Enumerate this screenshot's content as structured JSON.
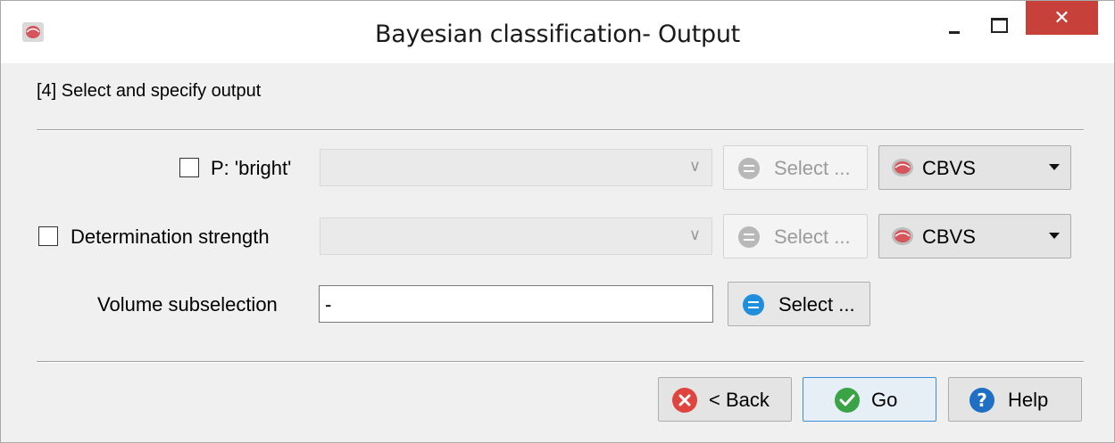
{
  "window": {
    "title": "Bayesian classification- Output",
    "close_symbol": "✕"
  },
  "step_label": "[4] Select and specify output",
  "rows": [
    {
      "checkbox_label": "P: 'bright'",
      "checked": false,
      "combo_value": "",
      "select_label": "Select ...",
      "format_label": "CBVS"
    },
    {
      "checkbox_label": "Determination strength",
      "checked": false,
      "combo_value": "",
      "select_label": "Select ...",
      "format_label": "CBVS"
    }
  ],
  "volume_subselection": {
    "label": "Volume subselection",
    "value": "-",
    "select_label": "Select ..."
  },
  "buttons": {
    "back": "< Back",
    "go": "Go",
    "help": "Help"
  },
  "icons": {
    "app": "opendtect-logo-icon",
    "select_disabled": "list-icon",
    "select_enabled": "list-icon",
    "back": "cross-circle-icon",
    "go": "check-circle-icon",
    "help": "question-circle-icon"
  },
  "colors": {
    "close_button": "#c7403a",
    "select_icon": "#1f8fdc",
    "back_icon": "#e0443e",
    "go_icon": "#3aa346",
    "help_icon": "#1f6fc4"
  }
}
